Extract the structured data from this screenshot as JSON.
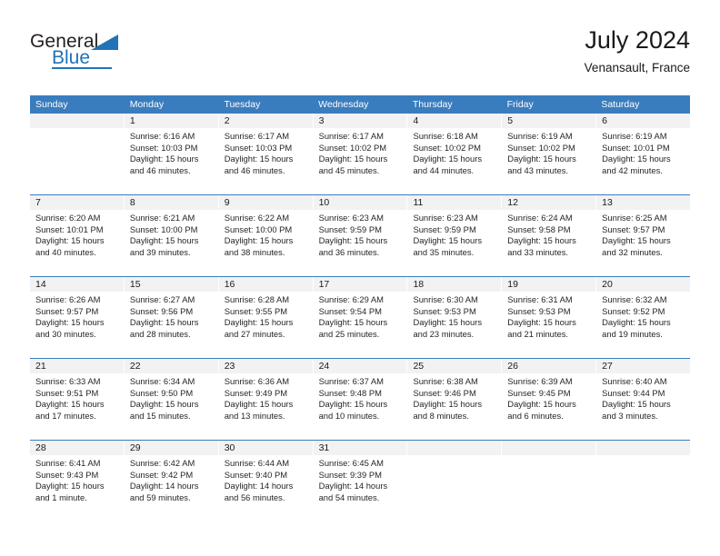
{
  "brand": {
    "word1": "General",
    "word2": "Blue",
    "flag_icon": "triangle-flag-icon",
    "accent_color": "#2272b8"
  },
  "header": {
    "title": "July 2024",
    "subtitle": "Venansault, France"
  },
  "theme": {
    "header_blue": "#3a7dbe",
    "day_band_gray": "#f2f2f2",
    "text": "#1a1a1a"
  },
  "calendar": {
    "weekday_headers": [
      "Sunday",
      "Monday",
      "Tuesday",
      "Wednesday",
      "Thursday",
      "Friday",
      "Saturday"
    ],
    "weeks": [
      [
        {
          "day": "",
          "sunrise": "",
          "sunset": "",
          "daylight1": "",
          "daylight2": "",
          "empty": true
        },
        {
          "day": "1",
          "sunrise": "Sunrise: 6:16 AM",
          "sunset": "Sunset: 10:03 PM",
          "daylight1": "Daylight: 15 hours",
          "daylight2": "and 46 minutes."
        },
        {
          "day": "2",
          "sunrise": "Sunrise: 6:17 AM",
          "sunset": "Sunset: 10:03 PM",
          "daylight1": "Daylight: 15 hours",
          "daylight2": "and 46 minutes."
        },
        {
          "day": "3",
          "sunrise": "Sunrise: 6:17 AM",
          "sunset": "Sunset: 10:02 PM",
          "daylight1": "Daylight: 15 hours",
          "daylight2": "and 45 minutes."
        },
        {
          "day": "4",
          "sunrise": "Sunrise: 6:18 AM",
          "sunset": "Sunset: 10:02 PM",
          "daylight1": "Daylight: 15 hours",
          "daylight2": "and 44 minutes."
        },
        {
          "day": "5",
          "sunrise": "Sunrise: 6:19 AM",
          "sunset": "Sunset: 10:02 PM",
          "daylight1": "Daylight: 15 hours",
          "daylight2": "and 43 minutes."
        },
        {
          "day": "6",
          "sunrise": "Sunrise: 6:19 AM",
          "sunset": "Sunset: 10:01 PM",
          "daylight1": "Daylight: 15 hours",
          "daylight2": "and 42 minutes."
        }
      ],
      [
        {
          "day": "7",
          "sunrise": "Sunrise: 6:20 AM",
          "sunset": "Sunset: 10:01 PM",
          "daylight1": "Daylight: 15 hours",
          "daylight2": "and 40 minutes."
        },
        {
          "day": "8",
          "sunrise": "Sunrise: 6:21 AM",
          "sunset": "Sunset: 10:00 PM",
          "daylight1": "Daylight: 15 hours",
          "daylight2": "and 39 minutes."
        },
        {
          "day": "9",
          "sunrise": "Sunrise: 6:22 AM",
          "sunset": "Sunset: 10:00 PM",
          "daylight1": "Daylight: 15 hours",
          "daylight2": "and 38 minutes."
        },
        {
          "day": "10",
          "sunrise": "Sunrise: 6:23 AM",
          "sunset": "Sunset: 9:59 PM",
          "daylight1": "Daylight: 15 hours",
          "daylight2": "and 36 minutes."
        },
        {
          "day": "11",
          "sunrise": "Sunrise: 6:23 AM",
          "sunset": "Sunset: 9:59 PM",
          "daylight1": "Daylight: 15 hours",
          "daylight2": "and 35 minutes."
        },
        {
          "day": "12",
          "sunrise": "Sunrise: 6:24 AM",
          "sunset": "Sunset: 9:58 PM",
          "daylight1": "Daylight: 15 hours",
          "daylight2": "and 33 minutes."
        },
        {
          "day": "13",
          "sunrise": "Sunrise: 6:25 AM",
          "sunset": "Sunset: 9:57 PM",
          "daylight1": "Daylight: 15 hours",
          "daylight2": "and 32 minutes."
        }
      ],
      [
        {
          "day": "14",
          "sunrise": "Sunrise: 6:26 AM",
          "sunset": "Sunset: 9:57 PM",
          "daylight1": "Daylight: 15 hours",
          "daylight2": "and 30 minutes."
        },
        {
          "day": "15",
          "sunrise": "Sunrise: 6:27 AM",
          "sunset": "Sunset: 9:56 PM",
          "daylight1": "Daylight: 15 hours",
          "daylight2": "and 28 minutes."
        },
        {
          "day": "16",
          "sunrise": "Sunrise: 6:28 AM",
          "sunset": "Sunset: 9:55 PM",
          "daylight1": "Daylight: 15 hours",
          "daylight2": "and 27 minutes."
        },
        {
          "day": "17",
          "sunrise": "Sunrise: 6:29 AM",
          "sunset": "Sunset: 9:54 PM",
          "daylight1": "Daylight: 15 hours",
          "daylight2": "and 25 minutes."
        },
        {
          "day": "18",
          "sunrise": "Sunrise: 6:30 AM",
          "sunset": "Sunset: 9:53 PM",
          "daylight1": "Daylight: 15 hours",
          "daylight2": "and 23 minutes."
        },
        {
          "day": "19",
          "sunrise": "Sunrise: 6:31 AM",
          "sunset": "Sunset: 9:53 PM",
          "daylight1": "Daylight: 15 hours",
          "daylight2": "and 21 minutes."
        },
        {
          "day": "20",
          "sunrise": "Sunrise: 6:32 AM",
          "sunset": "Sunset: 9:52 PM",
          "daylight1": "Daylight: 15 hours",
          "daylight2": "and 19 minutes."
        }
      ],
      [
        {
          "day": "21",
          "sunrise": "Sunrise: 6:33 AM",
          "sunset": "Sunset: 9:51 PM",
          "daylight1": "Daylight: 15 hours",
          "daylight2": "and 17 minutes."
        },
        {
          "day": "22",
          "sunrise": "Sunrise: 6:34 AM",
          "sunset": "Sunset: 9:50 PM",
          "daylight1": "Daylight: 15 hours",
          "daylight2": "and 15 minutes."
        },
        {
          "day": "23",
          "sunrise": "Sunrise: 6:36 AM",
          "sunset": "Sunset: 9:49 PM",
          "daylight1": "Daylight: 15 hours",
          "daylight2": "and 13 minutes."
        },
        {
          "day": "24",
          "sunrise": "Sunrise: 6:37 AM",
          "sunset": "Sunset: 9:48 PM",
          "daylight1": "Daylight: 15 hours",
          "daylight2": "and 10 minutes."
        },
        {
          "day": "25",
          "sunrise": "Sunrise: 6:38 AM",
          "sunset": "Sunset: 9:46 PM",
          "daylight1": "Daylight: 15 hours",
          "daylight2": "and 8 minutes."
        },
        {
          "day": "26",
          "sunrise": "Sunrise: 6:39 AM",
          "sunset": "Sunset: 9:45 PM",
          "daylight1": "Daylight: 15 hours",
          "daylight2": "and 6 minutes."
        },
        {
          "day": "27",
          "sunrise": "Sunrise: 6:40 AM",
          "sunset": "Sunset: 9:44 PM",
          "daylight1": "Daylight: 15 hours",
          "daylight2": "and 3 minutes."
        }
      ],
      [
        {
          "day": "28",
          "sunrise": "Sunrise: 6:41 AM",
          "sunset": "Sunset: 9:43 PM",
          "daylight1": "Daylight: 15 hours",
          "daylight2": "and 1 minute."
        },
        {
          "day": "29",
          "sunrise": "Sunrise: 6:42 AM",
          "sunset": "Sunset: 9:42 PM",
          "daylight1": "Daylight: 14 hours",
          "daylight2": "and 59 minutes."
        },
        {
          "day": "30",
          "sunrise": "Sunrise: 6:44 AM",
          "sunset": "Sunset: 9:40 PM",
          "daylight1": "Daylight: 14 hours",
          "daylight2": "and 56 minutes."
        },
        {
          "day": "31",
          "sunrise": "Sunrise: 6:45 AM",
          "sunset": "Sunset: 9:39 PM",
          "daylight1": "Daylight: 14 hours",
          "daylight2": "and 54 minutes."
        },
        {
          "day": "",
          "sunrise": "",
          "sunset": "",
          "daylight1": "",
          "daylight2": "",
          "empty": true
        },
        {
          "day": "",
          "sunrise": "",
          "sunset": "",
          "daylight1": "",
          "daylight2": "",
          "empty": true
        },
        {
          "day": "",
          "sunrise": "",
          "sunset": "",
          "daylight1": "",
          "daylight2": "",
          "empty": true
        }
      ]
    ]
  }
}
